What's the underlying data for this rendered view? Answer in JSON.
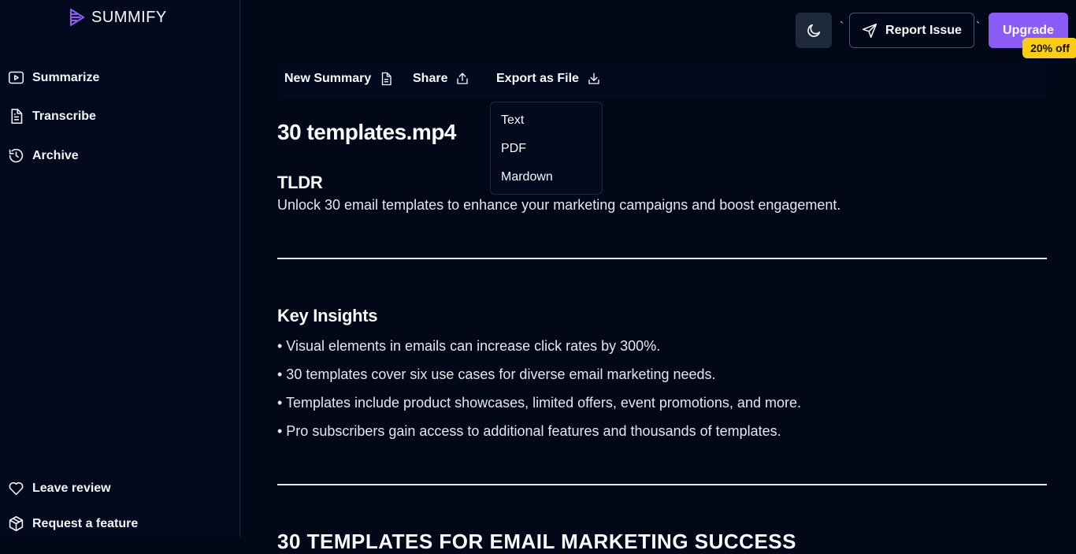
{
  "brand": {
    "name": "SUMMIFY",
    "accent": "#8b5cf6"
  },
  "sidebar": {
    "items": [
      {
        "label": "Summarize",
        "icon": "play-square-icon"
      },
      {
        "label": "Transcribe",
        "icon": "document-icon"
      },
      {
        "label": "Archive",
        "icon": "history-icon"
      }
    ],
    "bottom": [
      {
        "label": "Leave review",
        "icon": "heart-icon"
      },
      {
        "label": "Request a feature",
        "icon": "package-icon"
      }
    ]
  },
  "header": {
    "tick_left": "`",
    "tick_right": "`",
    "report_label": "Report Issue",
    "upgrade_label": "Upgrade",
    "discount_badge": "20% off"
  },
  "toolbar": {
    "new_summary": "New Summary",
    "share": "Share",
    "export": "Export as File"
  },
  "export_menu": {
    "options": [
      "Text",
      "PDF",
      "Mardown"
    ]
  },
  "content": {
    "title": "30 templates.mp4",
    "tldr_heading": "TLDR",
    "tldr_text": "Unlock 30 email templates to enhance your marketing campaigns and boost engagement.",
    "insights_heading": "Key Insights",
    "insights": [
      "• Visual elements in emails can increase click rates by 300%.",
      "• 30 templates cover six use cases for diverse email marketing needs.",
      "• Templates include product showcases, limited offers, event promotions, and more.",
      "• Pro subscribers gain access to additional features and thousands of templates."
    ],
    "next_heading": "30 TEMPLATES FOR EMAIL MARKETING SUCCESS"
  }
}
